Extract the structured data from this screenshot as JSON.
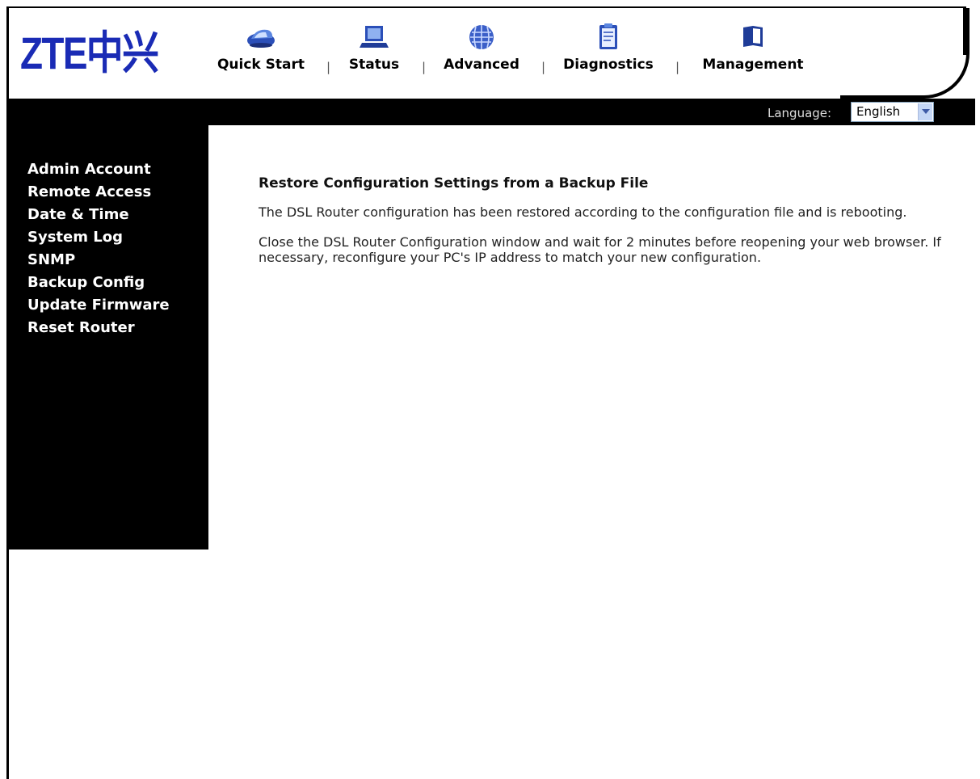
{
  "brand": {
    "logo_text": "ZTE中兴",
    "color": "#1a2bb5"
  },
  "nav": {
    "items": [
      {
        "label": "Quick Start",
        "icon": "car-icon"
      },
      {
        "label": "Status",
        "icon": "laptop-icon"
      },
      {
        "label": "Advanced",
        "icon": "globe-icon"
      },
      {
        "label": "Diagnostics",
        "icon": "clipboard-icon"
      },
      {
        "label": "Management",
        "icon": "book-icon"
      }
    ],
    "separator": "|"
  },
  "language": {
    "label": "Language:",
    "selected": "English"
  },
  "sidebar": {
    "items": [
      {
        "label": "Admin Account"
      },
      {
        "label": "Remote Access"
      },
      {
        "label": "Date & Time"
      },
      {
        "label": "System Log"
      },
      {
        "label": "SNMP"
      },
      {
        "label": "Backup Config"
      },
      {
        "label": "Update Firmware"
      },
      {
        "label": "Reset Router"
      }
    ]
  },
  "main": {
    "title": "Restore Configuration Settings from a Backup File",
    "paragraph1": "The DSL Router configuration has been restored according to the configuration file and is rebooting.",
    "paragraph2": "Close the DSL Router Configuration window and wait for 2 minutes before reopening your web browser. If necessary, reconfigure your PC's IP address to match your new configuration."
  }
}
